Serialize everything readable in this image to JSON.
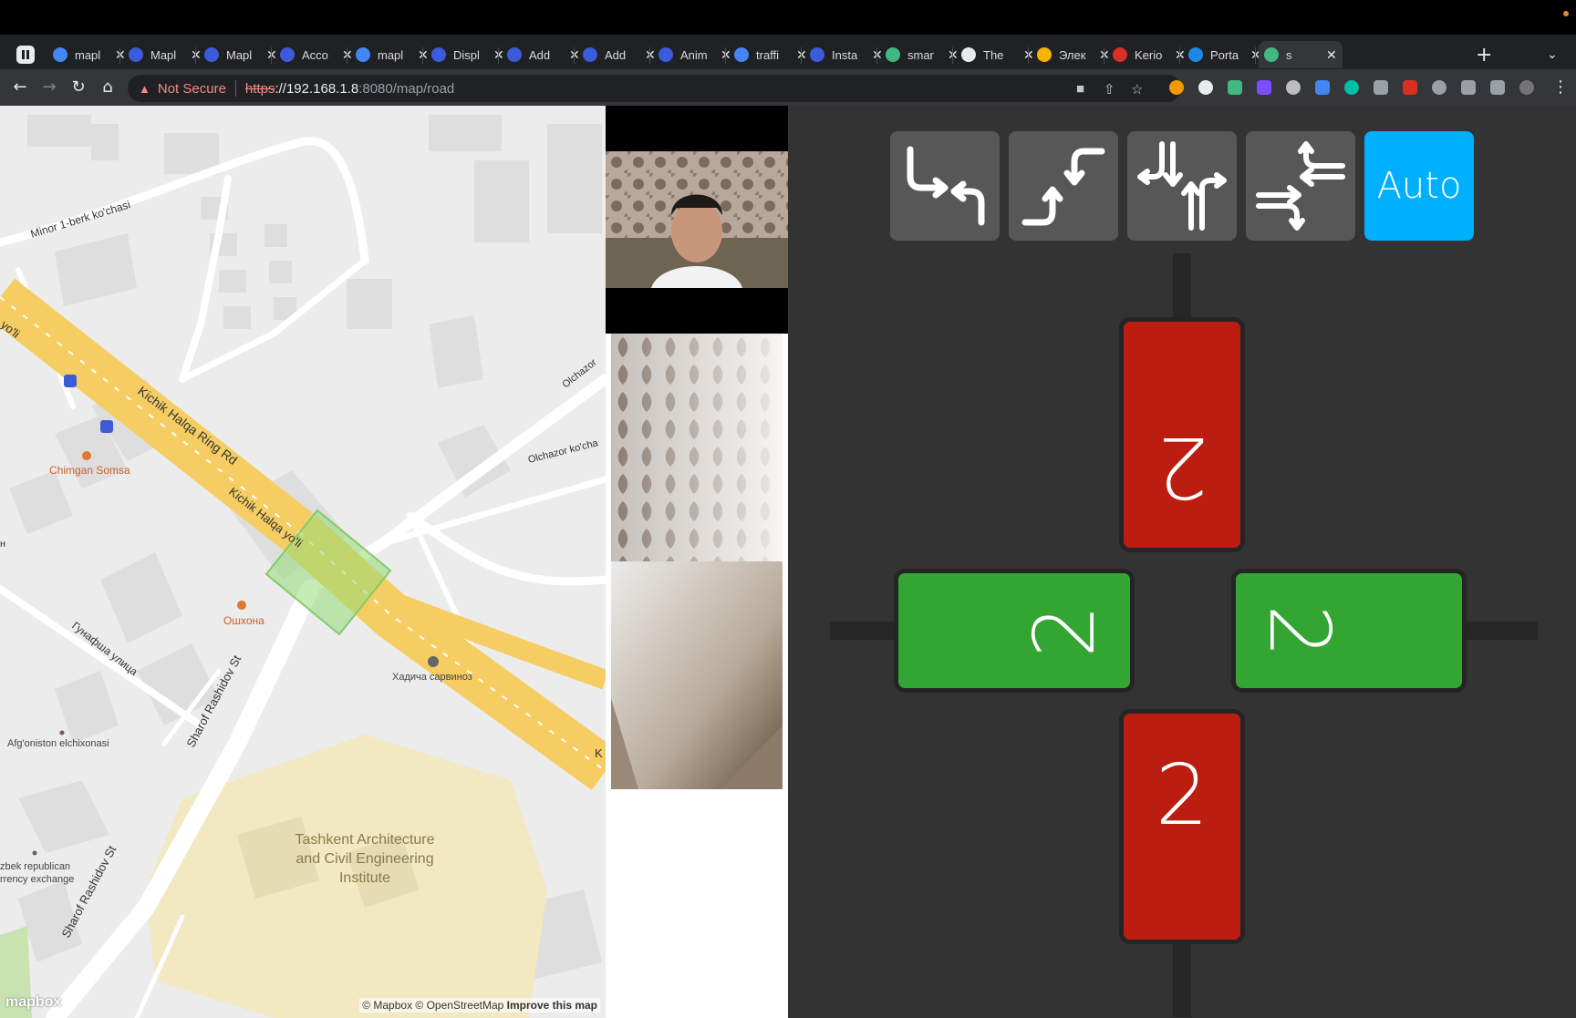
{
  "browser": {
    "tabs": [
      {
        "label": "mapl",
        "icon": "google-icon",
        "color": "#4285f4"
      },
      {
        "label": "Mapl",
        "icon": "phind-icon",
        "color": "#3b5bdb"
      },
      {
        "label": "Mapl",
        "icon": "phind-icon",
        "color": "#3b5bdb"
      },
      {
        "label": "Acco",
        "icon": "phind-icon",
        "color": "#3b5bdb"
      },
      {
        "label": "mapl",
        "icon": "google-icon",
        "color": "#4285f4"
      },
      {
        "label": "Displ",
        "icon": "phind-icon",
        "color": "#3b5bdb"
      },
      {
        "label": "Add",
        "icon": "phind-icon",
        "color": "#3b5bdb"
      },
      {
        "label": "Add",
        "icon": "phind-icon",
        "color": "#3b5bdb"
      },
      {
        "label": "Anim",
        "icon": "phind-icon",
        "color": "#3b5bdb"
      },
      {
        "label": "traffi",
        "icon": "google-icon",
        "color": "#4285f4"
      },
      {
        "label": "Insta",
        "icon": "phind-icon",
        "color": "#3b5bdb"
      },
      {
        "label": "smar",
        "icon": "vue-icon",
        "color": "#41b883"
      },
      {
        "label": "The",
        "icon": "openai-icon",
        "color": "#e8eaed"
      },
      {
        "label": "Элек",
        "icon": "slides-icon",
        "color": "#f4b400"
      },
      {
        "label": "Kerio",
        "icon": "shield-icon",
        "color": "#d93025"
      },
      {
        "label": "Porta",
        "icon": "docker-icon",
        "color": "#1e88e5"
      },
      {
        "label": "s",
        "icon": "vue-icon",
        "color": "#41b883"
      }
    ],
    "url_warning": "Not Secure",
    "url_scheme": "https",
    "url_host": "://192.168.1.8",
    "url_path": ":8080/map/road"
  },
  "map": {
    "labels": {
      "minor": "Minor 1-berk ko'chasi",
      "ring_rd": "Kichik Halqa Ring Rd",
      "halqa_yoli": "Kichik Halqa yo'li",
      "yoli_left": "yo'li",
      "chimgan": "Chimgan Somsa",
      "oshxona": "Ошхона",
      "gunafsha": "Гунафша улица",
      "sharof1": "Sharof Rashidov St",
      "sharof2": "Sharof Rashidov St",
      "afg": "Afg'oniston elchixonasi",
      "uzbek1": "zbek republican",
      "uzbek2": "rrency exchange",
      "hadicha": "Хадича сарвиноз",
      "olchazor1": "Olchazor",
      "olchazor2": "Olchazor ko'cha",
      "inst1": "Tashkent Architecture",
      "inst2": "and Civil Engineering",
      "inst3": "Institute",
      "k_edge": "K",
      "n_edge": "н"
    },
    "attribution": "© Mapbox © OpenStreetMap",
    "improve": "Improve this map",
    "logo": "mapbox"
  },
  "controls": {
    "modes": [
      {
        "name": "mode-left-turn-button",
        "icon": "left-turn-arrows-icon"
      },
      {
        "name": "mode-right-turn-button",
        "icon": "right-turn-arrows-icon"
      },
      {
        "name": "mode-north-south-button",
        "icon": "north-south-arrows-icon"
      },
      {
        "name": "mode-east-west-button",
        "icon": "east-west-arrows-icon"
      }
    ],
    "auto_label": "Auto",
    "accent": "#00b0ff"
  },
  "lights": {
    "north": {
      "count": "2",
      "state": "red"
    },
    "west": {
      "count": "2",
      "state": "green"
    },
    "east": {
      "count": "2",
      "state": "green"
    },
    "south": {
      "count": "2",
      "state": "red"
    }
  }
}
